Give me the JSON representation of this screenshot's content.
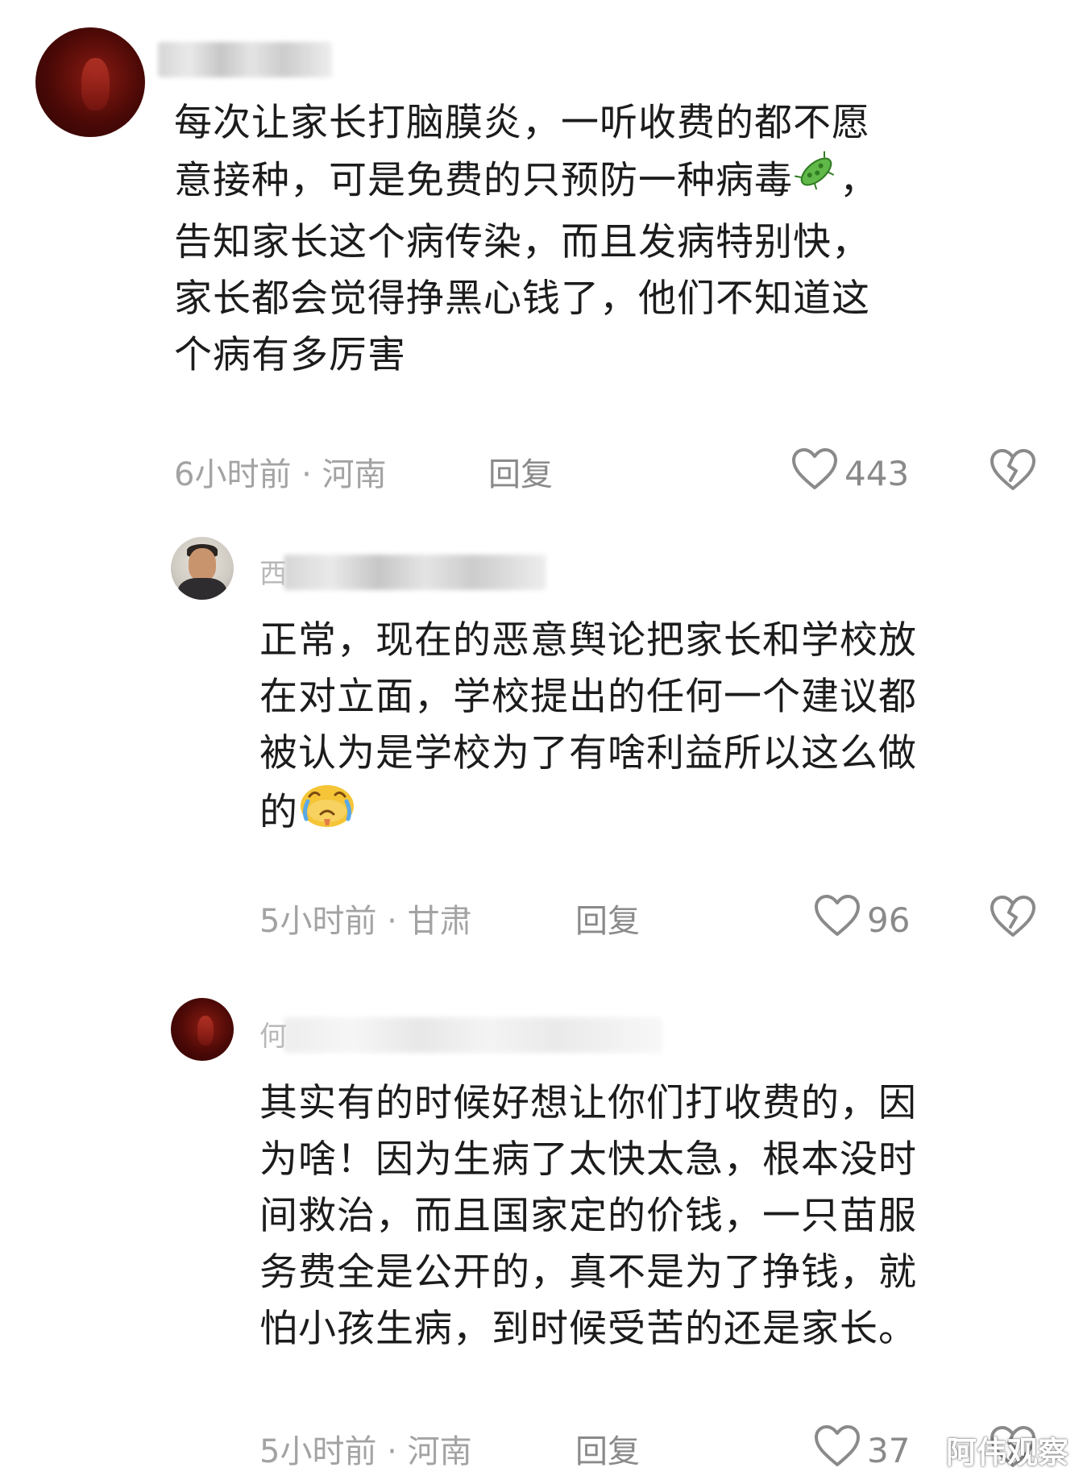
{
  "comments": [
    {
      "lines": [
        "每次让家长打脑膜炎，一听收费的都不愿",
        "意接种，可是免费的只预防一种病毒",
        "告知家长这个病传染，而且发病特别快，",
        "家长都会觉得挣黑心钱了，他们不知道这",
        "个病有多厉害"
      ],
      "emoji_tail": "，",
      "time": "6小时前",
      "location": "河南",
      "reply": "回复",
      "likes": "443"
    },
    {
      "username_visible": "西",
      "lines": [
        "正常，现在的恶意舆论把家长和学校放",
        "在对立面，学校提出的任何一个建议都",
        "被认为是学校为了有啥利益所以这么做",
        "的"
      ],
      "time": "5小时前",
      "location": "甘肃",
      "reply": "回复",
      "likes": "96"
    },
    {
      "username_visible": "何",
      "lines": [
        "其实有的时候好想让你们打收费的，因",
        "为啥！因为生病了太快太急，根本没时",
        "间救治，而且国家定的价钱，一只苗服",
        "务费全是公开的，真不是为了挣钱，就",
        "怕小孩生病，到时候受苦的还是家长。"
      ],
      "time": "5小时前",
      "location": "河南",
      "reply": "回复",
      "likes": "37"
    }
  ],
  "separator": " · ",
  "icons": {
    "like": "heart-outline-icon",
    "dislike": "broken-heart-icon",
    "virus_emoji": "microbe-emoji",
    "crying_emoji": "crying-face-emoji"
  },
  "colors": {
    "text": "#1c1c1c",
    "meta": "#a3a3a3",
    "icon": "#8a8a8a"
  },
  "watermark": "阿伟观察"
}
